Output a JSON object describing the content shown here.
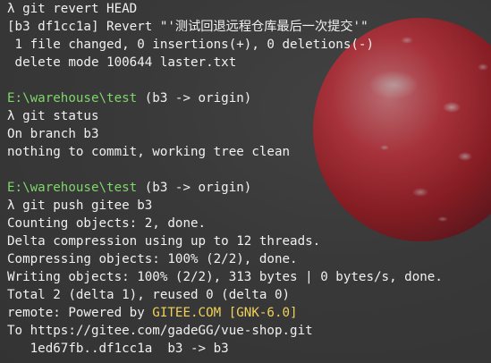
{
  "terminal": {
    "lines": [
      [
        {
          "text": "λ git revert HEAD",
          "color": "white"
        }
      ],
      [
        {
          "text": "[b3 df1cc1a] Revert \"'测试回退远程仓库最后一次提交'\"",
          "color": "white"
        }
      ],
      [
        {
          "text": " 1 file changed, 0 insertions(+), 0 deletions(-)",
          "color": "white"
        }
      ],
      [
        {
          "text": " delete mode 100644 laster.txt",
          "color": "white"
        }
      ],
      [],
      [
        {
          "text": "E:\\warehouse\\test",
          "color": "green"
        },
        {
          "text": " (b3 -> origin)",
          "color": "white"
        }
      ],
      [
        {
          "text": "λ git status",
          "color": "white"
        }
      ],
      [
        {
          "text": "On branch b3",
          "color": "white"
        }
      ],
      [
        {
          "text": "nothing to commit, working tree clean",
          "color": "white"
        }
      ],
      [],
      [
        {
          "text": "E:\\warehouse\\test",
          "color": "green"
        },
        {
          "text": " (b3 -> origin)",
          "color": "white"
        }
      ],
      [
        {
          "text": "λ git push gitee b3",
          "color": "white"
        }
      ],
      [
        {
          "text": "Counting objects: 2, done.",
          "color": "white"
        }
      ],
      [
        {
          "text": "Delta compression using up to 12 threads.",
          "color": "white"
        }
      ],
      [
        {
          "text": "Compressing objects: 100% (2/2), done.",
          "color": "white"
        }
      ],
      [
        {
          "text": "Writing objects: 100% (2/2), 313 bytes | 0 bytes/s, done.",
          "color": "white"
        }
      ],
      [
        {
          "text": "Total 2 (delta 1), reused 0 (delta 0)",
          "color": "white"
        }
      ],
      [
        {
          "text": "remote: Powered by ",
          "color": "white"
        },
        {
          "text": "GITEE.COM",
          "color": "yellow"
        },
        {
          "text": " ",
          "color": "white"
        },
        {
          "text": "[GNK-6.0]",
          "color": "yellow"
        }
      ],
      [
        {
          "text": "To https://gitee.com/gadeGG/vue-shop.git",
          "color": "white"
        }
      ],
      [
        {
          "text": "   1ed67fb..df1cc1a  b3 -> b3",
          "color": "white"
        }
      ]
    ]
  },
  "colors": {
    "white": "#f0f0f0",
    "green": "#7fd66b",
    "yellow": "#f0d15a"
  },
  "wallpaper": {
    "icon": "red-fruit-image"
  }
}
